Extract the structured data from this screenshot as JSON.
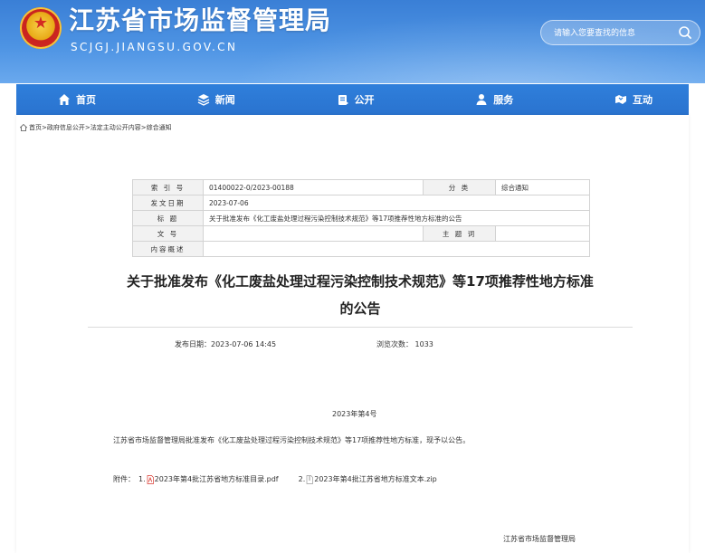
{
  "header": {
    "site_title": "江苏省市场监督管理局",
    "domain": "SCJGJ.JIANGSU.GOV.CN",
    "search_placeholder": "请输入您要查找的信息"
  },
  "nav": [
    {
      "label": "首页",
      "icon": "home-icon"
    },
    {
      "label": "新闻",
      "icon": "news-icon"
    },
    {
      "label": "公开",
      "icon": "open-icon"
    },
    {
      "label": "服务",
      "icon": "service-icon"
    },
    {
      "label": "互动",
      "icon": "interact-icon"
    }
  ],
  "breadcrumb": {
    "home": "首页",
    "sep1": ">",
    "gov": "政府信息公开",
    "sep2": ">",
    "content": "法定主动公开内容",
    "sep3": ">",
    "current": "综合通知"
  },
  "meta": {
    "index_label": "索 引 号",
    "index_value": "01400022-0/2023-00188",
    "category_label": "分 类",
    "category_value": "综合通知",
    "date_label": "发文日期",
    "date_value": "2023-07-06",
    "title_label": "标 题",
    "title_value": "关于批准发布《化工废盐处理过程污染控制技术规范》等17项推荐性地方标准的公告",
    "doc_no_label": "文 号",
    "doc_no_value": "",
    "subject_label": "主 题 词",
    "subject_value": "",
    "summary_label": "内容概述",
    "summary_value": ""
  },
  "article": {
    "title_line1": "关于批准发布《化工废盐处理过程污染控制技术规范》等17项推荐性地方标准",
    "title_line2": "的公告",
    "publish_date": "发布日期：2023-07-06 14:45",
    "views": "浏览次数：  1033",
    "issue_no": "2023年第4号",
    "body": "江苏省市场监督管理局批准发布《化工废盐处理过程污染控制技术规范》等17项推荐性地方标准，现予以公告。",
    "attach_label": "附件：",
    "attach1_prefix": "1.",
    "attach1_name": "2023年第4批江苏省地方标准目录.pdf",
    "attach2_prefix": "2.",
    "attach2_name": "2023年第4批江苏省地方标准文本.zip",
    "signer": "江苏省市场监督管理局"
  },
  "colors": {
    "header_blue": "#4d93e3",
    "nav_blue": "#2f7fdb",
    "pdf_red": "#d9352c"
  }
}
